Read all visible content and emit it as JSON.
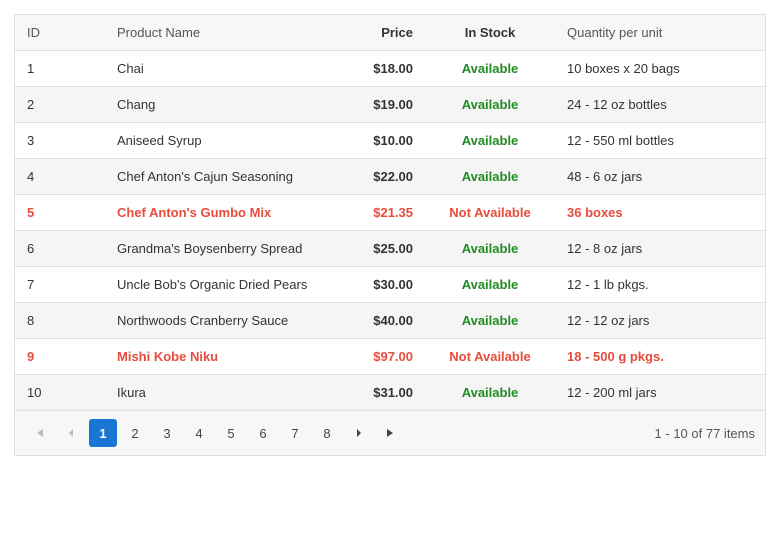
{
  "columns": {
    "id": {
      "label": "ID",
      "strong": false
    },
    "name": {
      "label": "Product Name",
      "strong": false
    },
    "price": {
      "label": "Price",
      "strong": true
    },
    "stock": {
      "label": "In Stock",
      "strong": true
    },
    "qty": {
      "label": "Quantity per unit",
      "strong": false
    }
  },
  "stock_labels": {
    "available": "Available",
    "not_available": "Not Available"
  },
  "rows": [
    {
      "id": "1",
      "name": "Chai",
      "price": "$18.00",
      "in_stock": true,
      "qty": "10 boxes x 20 bags"
    },
    {
      "id": "2",
      "name": "Chang",
      "price": "$19.00",
      "in_stock": true,
      "qty": "24 - 12 oz bottles"
    },
    {
      "id": "3",
      "name": "Aniseed Syrup",
      "price": "$10.00",
      "in_stock": true,
      "qty": "12 - 550 ml bottles"
    },
    {
      "id": "4",
      "name": "Chef Anton's Cajun Seasoning",
      "price": "$22.00",
      "in_stock": true,
      "qty": "48 - 6 oz jars"
    },
    {
      "id": "5",
      "name": "Chef Anton's Gumbo Mix",
      "price": "$21.35",
      "in_stock": false,
      "qty": "36 boxes"
    },
    {
      "id": "6",
      "name": "Grandma's Boysenberry Spread",
      "price": "$25.00",
      "in_stock": true,
      "qty": "12 - 8 oz jars"
    },
    {
      "id": "7",
      "name": "Uncle Bob's Organic Dried Pears",
      "price": "$30.00",
      "in_stock": true,
      "qty": "12 - 1 lb pkgs."
    },
    {
      "id": "8",
      "name": "Northwoods Cranberry Sauce",
      "price": "$40.00",
      "in_stock": true,
      "qty": "12 - 12 oz jars"
    },
    {
      "id": "9",
      "name": "Mishi Kobe Niku",
      "price": "$97.00",
      "in_stock": false,
      "qty": "18 - 500 g pkgs."
    },
    {
      "id": "10",
      "name": "Ikura",
      "price": "$31.00",
      "in_stock": true,
      "qty": "12 - 200 ml jars"
    }
  ],
  "pager": {
    "page_numbers": [
      "1",
      "2",
      "3",
      "4",
      "5",
      "6",
      "7",
      "8"
    ],
    "current_page": "1",
    "info": "1 - 10 of 77 items"
  }
}
